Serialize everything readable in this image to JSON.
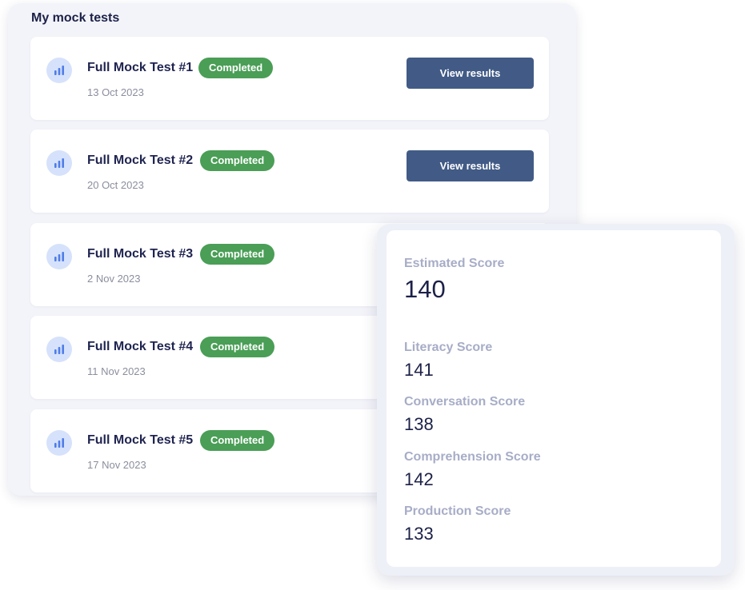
{
  "panel": {
    "title": "My mock tests"
  },
  "tests": [
    {
      "title": "Full Mock Test #1",
      "date": "13 Oct 2023",
      "status": "Completed",
      "action": "View results"
    },
    {
      "title": "Full Mock Test #2",
      "date": "20 Oct 2023",
      "status": "Completed",
      "action": "View results"
    },
    {
      "title": "Full Mock Test #3",
      "date": "2 Nov 2023",
      "status": "Completed"
    },
    {
      "title": "Full Mock Test #4",
      "date": "11 Nov 2023",
      "status": "Completed"
    },
    {
      "title": "Full Mock Test #5",
      "date": "17 Nov 2023",
      "status": "Completed"
    }
  ],
  "scores": {
    "estimated": {
      "label": "Estimated Score",
      "value": "140"
    },
    "items": [
      {
        "label": "Literacy Score",
        "value": "141"
      },
      {
        "label": "Conversation Score",
        "value": "138"
      },
      {
        "label": "Comprehension Score",
        "value": "142"
      },
      {
        "label": "Production Score",
        "value": "133"
      }
    ]
  },
  "icons": {
    "test": "bar-chart-icon"
  },
  "colors": {
    "status_completed": "#4a9e56",
    "button": "#425b86",
    "icon_bg": "#d6e2fb",
    "icon_fg": "#4f7de8"
  }
}
